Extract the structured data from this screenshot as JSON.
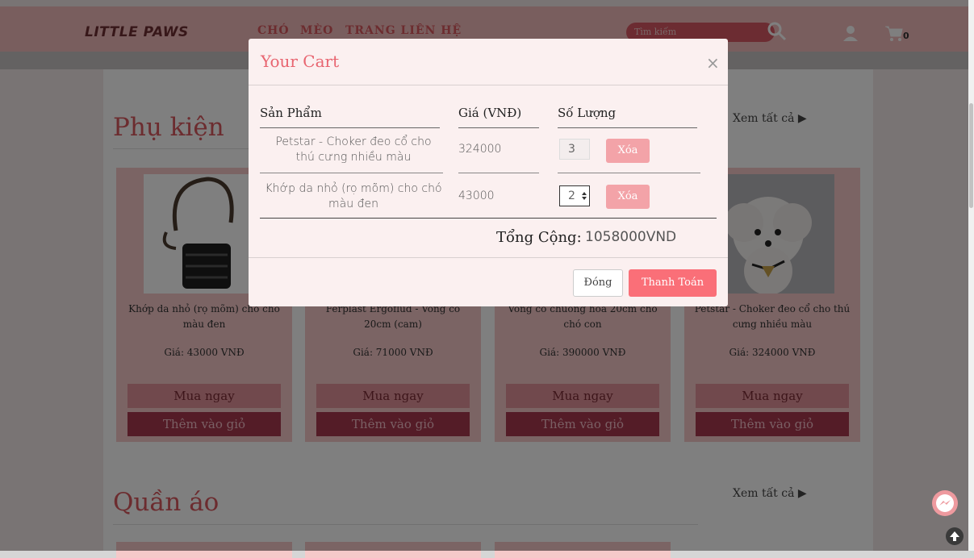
{
  "navbar": {
    "brand": "LITTLE PAWS",
    "links": [
      "CHÓ",
      "MÈO",
      "TRANG LIÊN HỆ"
    ],
    "search_placeholder": "Tìm kiếm",
    "cart_count": "0"
  },
  "sections": [
    {
      "title": "Phụ kiện",
      "see_all": "Xem tất cả ▶",
      "products": [
        {
          "name": "Khớp da nhỏ (rọ mõm) cho chó màu đen",
          "price": "Giá: 43000 VNĐ",
          "buy": "Mua ngay",
          "add": "Thêm vào giỏ"
        },
        {
          "name": "Ferplast Ergoflud - Vòng cổ 20cm (cam)",
          "price": "Giá: 71000 VNĐ",
          "buy": "Mua ngay",
          "add": "Thêm vào giỏ"
        },
        {
          "name": "Vòng cổ chuông hoa 20cm cho chó con",
          "price": "Giá: 390000 VNĐ",
          "buy": "Mua ngay",
          "add": "Thêm vào giỏ"
        },
        {
          "name": "Petstar - Choker đeo cổ cho thú cưng nhiều màu",
          "price": "Giá: 324000 VNĐ",
          "buy": "Mua ngay",
          "add": "Thêm vào giỏ"
        }
      ]
    },
    {
      "title": "Quần áo",
      "see_all": "Xem tất cả ▶"
    }
  ],
  "cart_modal": {
    "title": "Your Cart",
    "close_symbol": "×",
    "headers": {
      "product": "Sản Phẩm",
      "price": "Giá (VNĐ)",
      "quantity": "Số Lượng"
    },
    "items": [
      {
        "name": "Petstar - Choker đeo cổ cho thú cưng nhiều màu",
        "price": "324000",
        "quantity": "3",
        "delete": "Xóa"
      },
      {
        "name": "Khớp da nhỏ (rọ mõm) cho chó màu đen",
        "price": "43000",
        "quantity": "2",
        "delete": "Xóa"
      }
    ],
    "total_label": "Tổng Cộng:",
    "total_value": "1058000VND",
    "close_button": "Đóng",
    "checkout_button": "Thanh Toán"
  },
  "colors": {
    "accent": "#d9585e",
    "navbar": "#f3bcbc",
    "card_bg": "#f6c9c9",
    "buy_button": "#e3939a",
    "add_button": "#a8384e",
    "checkout": "#fa6f78"
  },
  "icons": [
    "search-icon",
    "user-icon",
    "cart-icon",
    "messenger-icon",
    "arrow-up-icon",
    "close-icon"
  ]
}
